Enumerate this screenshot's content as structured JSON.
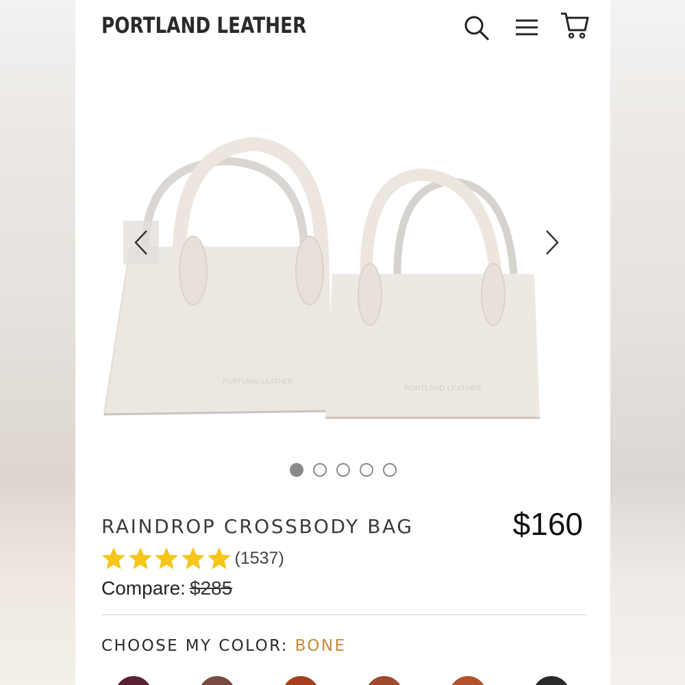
{
  "brand": {
    "logo_text": "PORTLAND LEATHER"
  },
  "header": {
    "icons": [
      "search-icon",
      "menu-icon",
      "cart-icon"
    ]
  },
  "gallery": {
    "image_alt": "Two bone leather tote bags",
    "embossed_text": "PORTLAND LEATHER",
    "slide_count": 5,
    "active_slide": 1
  },
  "product": {
    "title": "RAINDROP CROSSBODY BAG",
    "price": "$160",
    "rating_stars": 5,
    "review_count": "(1537)",
    "compare_label": "Compare:",
    "compare_price": "$285",
    "color_label": "CHOOSE MY COLOR:",
    "color_value": "BONE",
    "swatch_colors": [
      "#5a2036",
      "#7a4a40",
      "#a4401e",
      "#9e4a2c",
      "#b2532a",
      "#2a2a2a"
    ]
  },
  "colors": {
    "star": "#f5c518",
    "accent": "#c58a36",
    "bag": "#ece7e0"
  }
}
